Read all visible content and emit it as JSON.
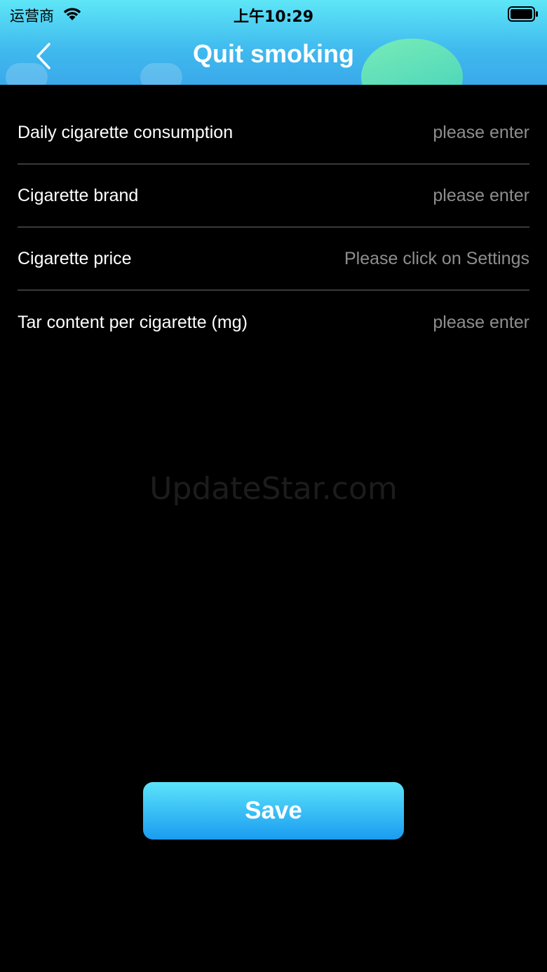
{
  "status_bar": {
    "carrier": "运营商",
    "time": "上午10:29"
  },
  "header": {
    "title": "Quit smoking",
    "back_icon": "chevron-left-icon"
  },
  "form": {
    "rows": [
      {
        "label": "Daily cigarette consumption",
        "placeholder": "please enter"
      },
      {
        "label": "Cigarette brand",
        "placeholder": "please enter"
      },
      {
        "label": "Cigarette price",
        "placeholder": "Please click on Settings"
      },
      {
        "label": "Tar content per cigarette (mg)",
        "placeholder": "please enter"
      }
    ]
  },
  "watermark": "UpdateStar.com",
  "save_label": "Save",
  "colors": {
    "header_top": "#5ee6f7",
    "header_bottom": "#3aa9ea",
    "button_top": "#5ce3fa",
    "button_bottom": "#1a9cf0",
    "background": "#000000",
    "placeholder": "#8e8e8e"
  }
}
